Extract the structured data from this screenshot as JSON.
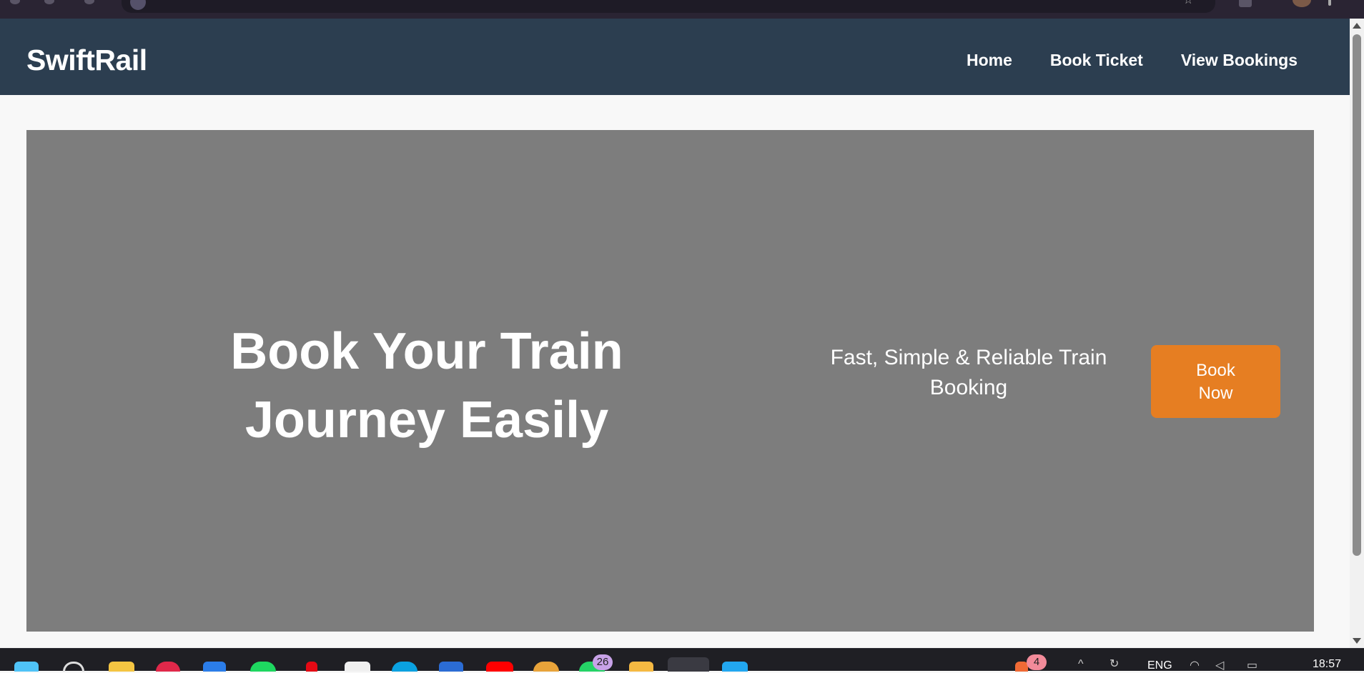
{
  "app": {
    "brand": "SwiftRail"
  },
  "nav": {
    "items": [
      {
        "label": "Home"
      },
      {
        "label": "Book Ticket"
      },
      {
        "label": "View Bookings"
      }
    ]
  },
  "hero": {
    "title": "Book Your Train Journey Easily",
    "subtitle": "Fast, Simple & Reliable Train Booking",
    "cta_label": "Book Now"
  },
  "taskbar": {
    "whatsapp_badge": "26",
    "tray_badge": "4",
    "language": "ENG",
    "time": "18:57"
  },
  "colors": {
    "navbar": "#2c3e50",
    "hero_bg": "#7d7d7d",
    "cta": "#e67e22",
    "page_bg": "#f8f8f8"
  }
}
